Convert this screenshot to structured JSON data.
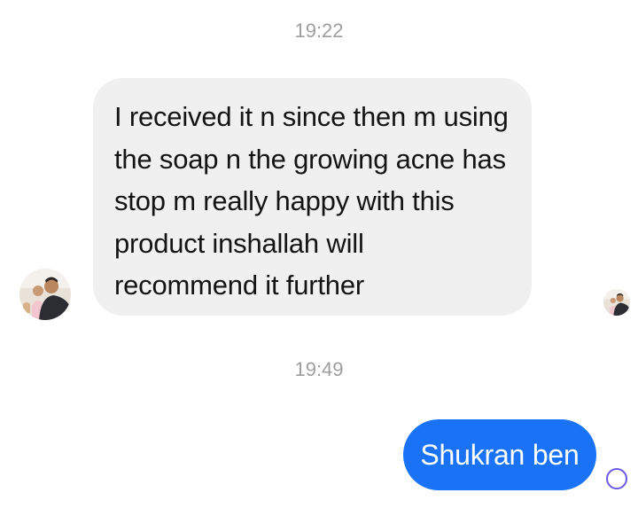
{
  "conversation": {
    "messages": [
      {
        "timestamp": "19:22",
        "direction": "incoming",
        "text": "I received it n since then m using the soap n the growing acne has stop m really happy with this product inshallah will recommend it further"
      },
      {
        "timestamp": "19:49",
        "direction": "outgoing",
        "text": "Shukran ben"
      }
    ]
  },
  "icons": {
    "sender_avatar": "avatar-photo",
    "read_receipt_avatar": "avatar-photo",
    "sent_status": "circle-outline-icon"
  },
  "colors": {
    "incoming_bubble": "#f0f0f0",
    "outgoing_bubble": "#1a73f7",
    "timestamp_text": "#9e9e9e",
    "status_ring": "#6a5ae0"
  }
}
